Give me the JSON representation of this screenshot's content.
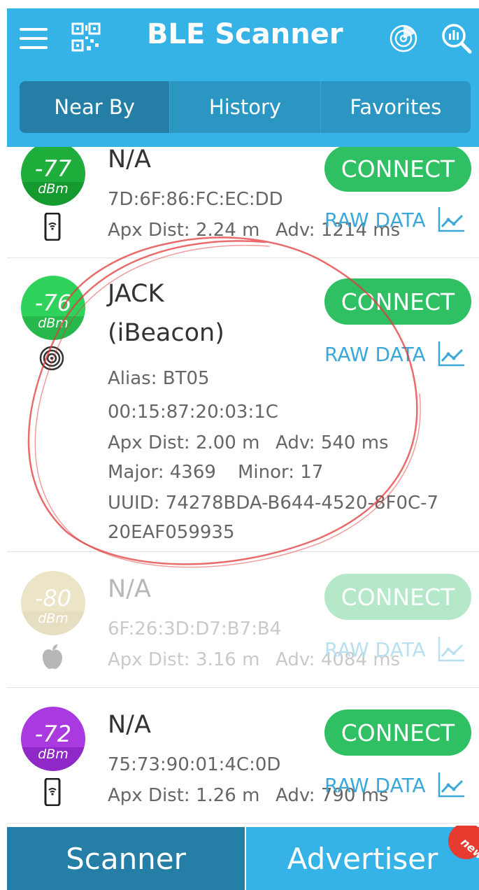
{
  "header": {
    "title": "BLE Scanner",
    "tabs": [
      {
        "label": "Near By",
        "active": true
      },
      {
        "label": "History",
        "active": false
      },
      {
        "label": "Favorites",
        "active": false
      }
    ]
  },
  "devices": [
    {
      "rssi": "-77",
      "unit": "dBm",
      "color_top": "#1fae3b",
      "color_bottom": "#159a2f",
      "icon": "phone-icon",
      "name": "N/A",
      "mac": "7D:6F:86:FC:EC:DD",
      "dist": "Apx Dist: 2.24 m",
      "adv": "Adv: 1214 ms",
      "connect": "CONNECT",
      "raw": "RAW DATA"
    },
    {
      "rssi": "-76",
      "unit": "dBm",
      "color_top": "#2fd25a",
      "color_bottom": "#27b84c",
      "icon": "beacon-icon",
      "name_line1": "JACK",
      "name_line2": "(iBeacon)",
      "alias": "Alias: BT05",
      "mac": "00:15:87:20:03:1C",
      "dist": "Apx Dist: 2.00 m",
      "adv": "Adv: 540 ms",
      "major": "Major: 4369",
      "minor": "Minor: 17",
      "uuid_line1": "UUID: 74278BDA-B644-4520-8F0C-7",
      "uuid_line2": "20EAF059935",
      "connect": "CONNECT",
      "raw": "RAW DATA"
    },
    {
      "rssi": "-80",
      "unit": "dBm",
      "color_top": "#c8b560",
      "color_bottom": "#b8a350",
      "icon": "apple-icon",
      "name": "N/A",
      "mac": "6F:26:3D:D7:B7:B4",
      "dist": "Apx Dist: 3.16 m",
      "adv": "Adv: 4084 ms",
      "connect": "CONNECT",
      "raw": "RAW DATA"
    },
    {
      "rssi": "-72",
      "unit": "dBm",
      "color_top": "#a83adf",
      "color_bottom": "#8f28c6",
      "icon": "phone-icon",
      "name": "N/A",
      "mac": "75:73:90:01:4C:0D",
      "dist": "Apx Dist: 1.26 m",
      "adv": "Adv: 790 ms",
      "connect": "CONNECT",
      "raw": "RAW DATA"
    }
  ],
  "bottom_nav": {
    "scanner": "Scanner",
    "advertiser": "Advertiser",
    "badge": "new"
  },
  "colors": {
    "header": "#35b3e6",
    "tab_active": "#247ea6",
    "connect": "#2ec063",
    "raw_data": "#3aa8d8",
    "annotation": "#e23a3a"
  }
}
